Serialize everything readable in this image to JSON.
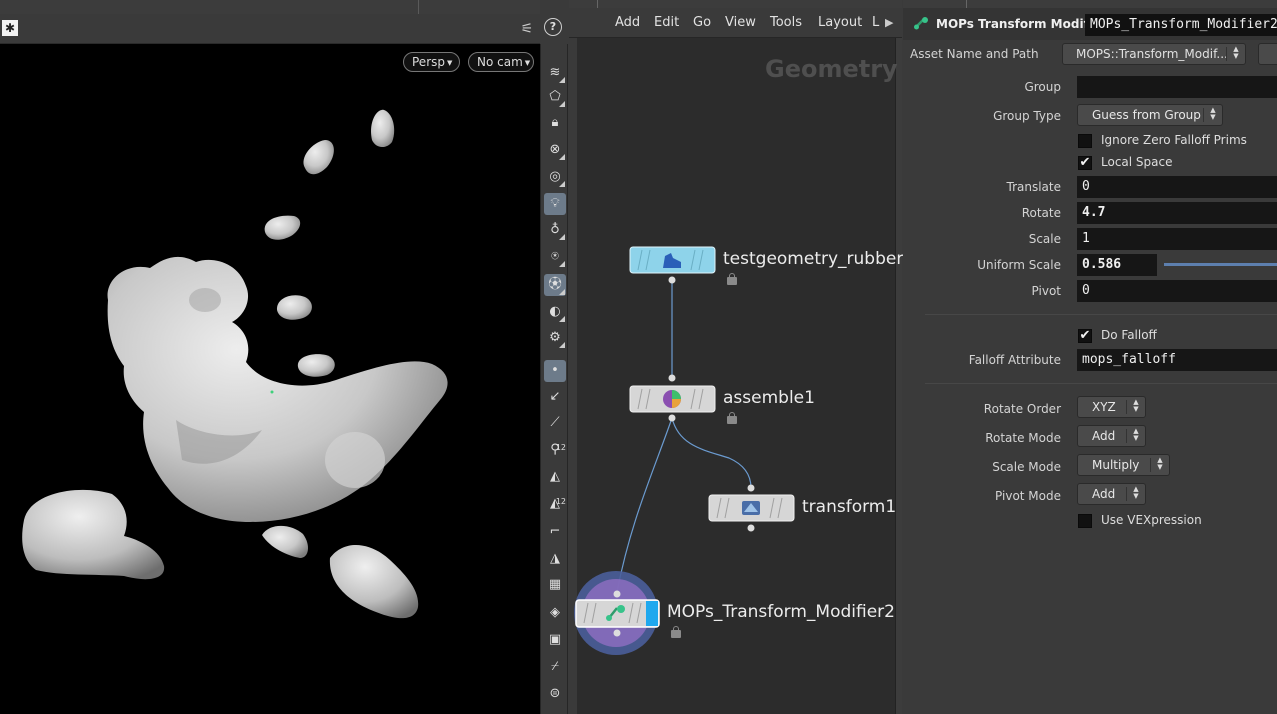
{
  "viewport": {
    "camera_buttons": [
      {
        "label": "Persp"
      },
      {
        "label": "No cam"
      }
    ]
  },
  "network": {
    "menu": [
      "Add",
      "Edit",
      "Go",
      "View",
      "Tools",
      "Layout",
      "L"
    ],
    "context_label": "Geometry",
    "nodes": [
      {
        "name": "testgeometry_rubbert",
        "color": "#8ed3ea"
      },
      {
        "name": "assemble1"
      },
      {
        "name": "transform1"
      },
      {
        "name": "MOPs_Transform_Modifier2",
        "flag_color": "#1fa8ee"
      }
    ]
  },
  "params": {
    "header": {
      "type_label": "MOPs Transform Modifier",
      "node_name": "MOPs_Transform_Modifier2"
    },
    "asset": {
      "label": "Asset Name and Path",
      "value": "MOPS::Transform_Modif..."
    },
    "group": {
      "label": "Group",
      "value": ""
    },
    "group_type": {
      "label": "Group Type",
      "value": "Guess from Group"
    },
    "ignore_zero": {
      "label": "Ignore Zero Falloff Prims",
      "checked": false
    },
    "local_space": {
      "label": "Local Space",
      "checked": true,
      "mark": "✔"
    },
    "translate": {
      "label": "Translate",
      "value": "0"
    },
    "rotate": {
      "label": "Rotate",
      "value": "4.7"
    },
    "scale": {
      "label": "Scale",
      "value": "1"
    },
    "uniform_scale": {
      "label": "Uniform Scale",
      "value": "0.586"
    },
    "pivot": {
      "label": "Pivot",
      "value": "0"
    },
    "do_falloff": {
      "label": "Do Falloff",
      "checked": true,
      "mark": "✔"
    },
    "falloff_attribute": {
      "label": "Falloff Attribute",
      "value": "mops_falloff"
    },
    "rotate_order": {
      "label": "Rotate Order",
      "value": "XYZ"
    },
    "rotate_mode": {
      "label": "Rotate Mode",
      "value": "Add"
    },
    "scale_mode": {
      "label": "Scale Mode",
      "value": "Multiply"
    },
    "pivot_mode": {
      "label": "Pivot Mode",
      "value": "Add"
    },
    "use_vex": {
      "label": "Use VEXpression",
      "checked": false
    }
  },
  "help_glyph": "?"
}
